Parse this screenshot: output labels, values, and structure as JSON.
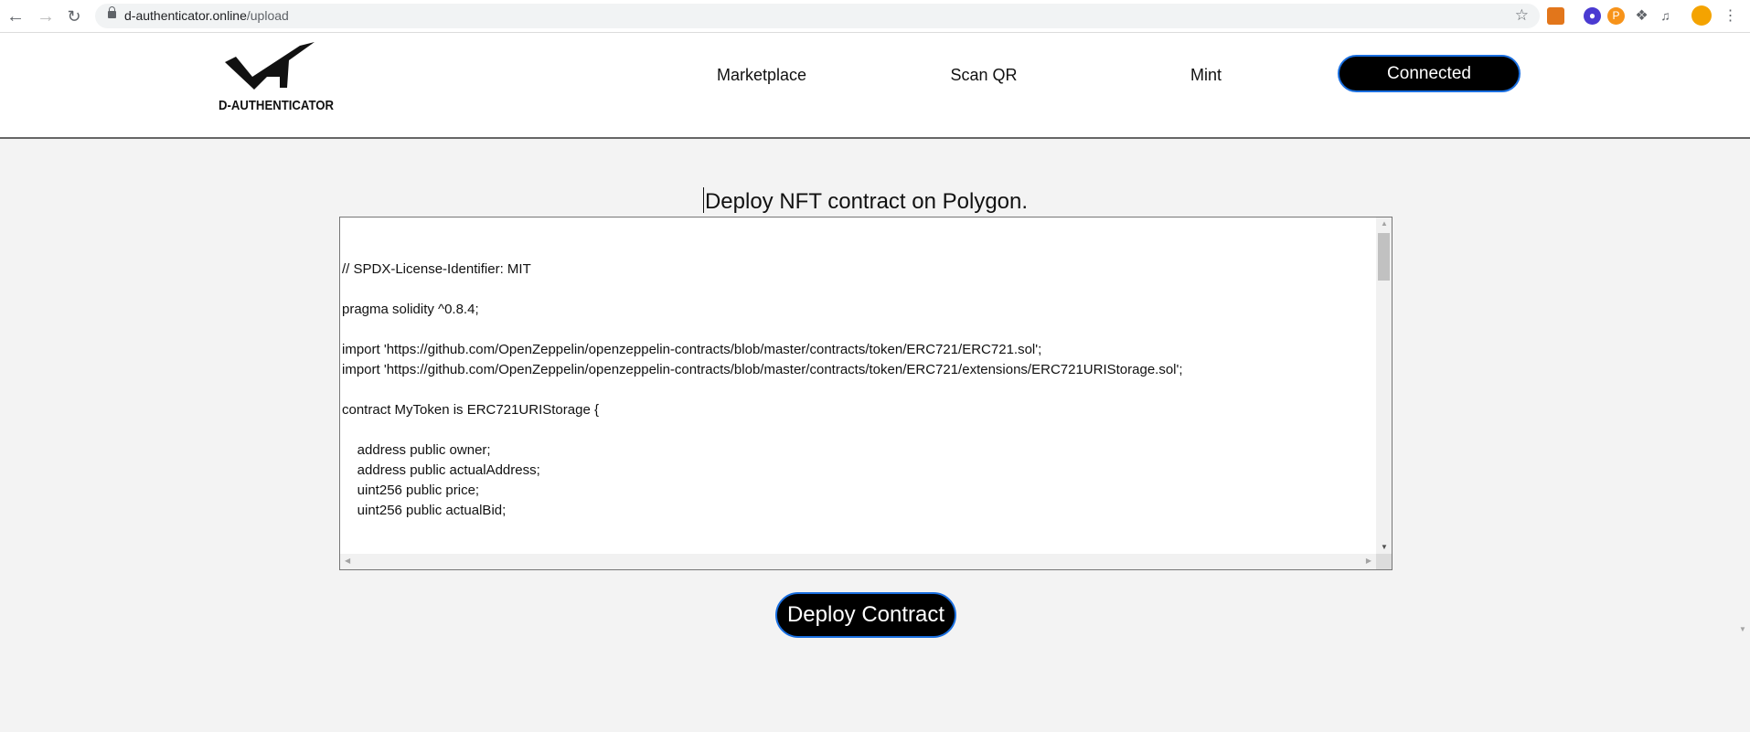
{
  "browser": {
    "url_host": "d-authenticator.online",
    "url_path": "/upload",
    "icons": [
      "back-icon",
      "forward-icon",
      "reload-icon",
      "lock-icon",
      "star-icon",
      "metamask-icon",
      "extension-ghost-icon",
      "extension-p-icon",
      "puzzle-icon",
      "media-icon",
      "profile-avatar",
      "menu-icon"
    ]
  },
  "header": {
    "logo_text": "D-AUTHENTICATOR",
    "nav": [
      "Marketplace",
      "Scan QR",
      "Mint"
    ],
    "connect_label": "Connected"
  },
  "main": {
    "title": "Deploy NFT contract on Polygon.",
    "code": "\n\n// SPDX-License-Identifier: MIT\n\npragma solidity ^0.8.4;\n\nimport 'https://github.com/OpenZeppelin/openzeppelin-contracts/blob/master/contracts/token/ERC721/ERC721.sol';\nimport 'https://github.com/OpenZeppelin/openzeppelin-contracts/blob/master/contracts/token/ERC721/extensions/ERC721URIStorage.sol';\n\ncontract MyToken is ERC721URIStorage {\n\n    address public owner;\n    address public actualAddress;\n    uint256 public price;\n    uint256 public actualBid;",
    "deploy_label": "Deploy Contract"
  },
  "colors": {
    "accent_border": "#1a6fe0",
    "button_bg": "#000000",
    "page_bg": "#f3f3f3"
  }
}
